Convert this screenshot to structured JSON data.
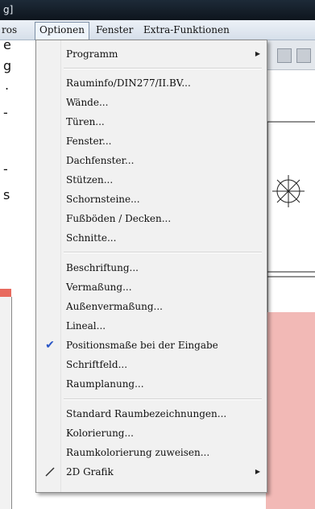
{
  "window": {
    "title_fragment": "g]"
  },
  "menubar": [
    {
      "label": "ros"
    },
    {
      "label": "Optionen"
    },
    {
      "label": "Fenster"
    },
    {
      "label": "Extra-Funktionen"
    }
  ],
  "left_text": [
    "e",
    "g",
    ".",
    "-",
    "-",
    "s"
  ],
  "menu": {
    "groups": [
      [
        {
          "label": "Programm",
          "submenu": true
        }
      ],
      [
        {
          "label": "Rauminfo/DIN277/II.BV..."
        },
        {
          "label": "Wände..."
        },
        {
          "label": "Türen..."
        },
        {
          "label": "Fenster..."
        },
        {
          "label": "Dachfenster..."
        },
        {
          "label": "Stützen..."
        },
        {
          "label": "Schornsteine..."
        },
        {
          "label": "Fußböden / Decken..."
        },
        {
          "label": "Schnitte..."
        }
      ],
      [
        {
          "label": "Beschriftung..."
        },
        {
          "label": "Vermaßung..."
        },
        {
          "label": "Außenvermaßung..."
        },
        {
          "label": "Lineal..."
        },
        {
          "label": "Positionsmaße bei der Eingabe",
          "checked": true
        },
        {
          "label": "Schriftfeld..."
        },
        {
          "label": "Raumplanung..."
        }
      ],
      [
        {
          "label": "Standard Raumbezeichnungen..."
        },
        {
          "label": "Kolorierung..."
        },
        {
          "label": "Raumkolorierung zuweisen..."
        },
        {
          "label": "2D Grafik",
          "submenu": true,
          "icon": "pencil-line-icon"
        }
      ]
    ]
  },
  "colors": {
    "check": "#2a56c6",
    "pink_area": "#f2b9b6",
    "accent_red": "#e86a5e"
  }
}
